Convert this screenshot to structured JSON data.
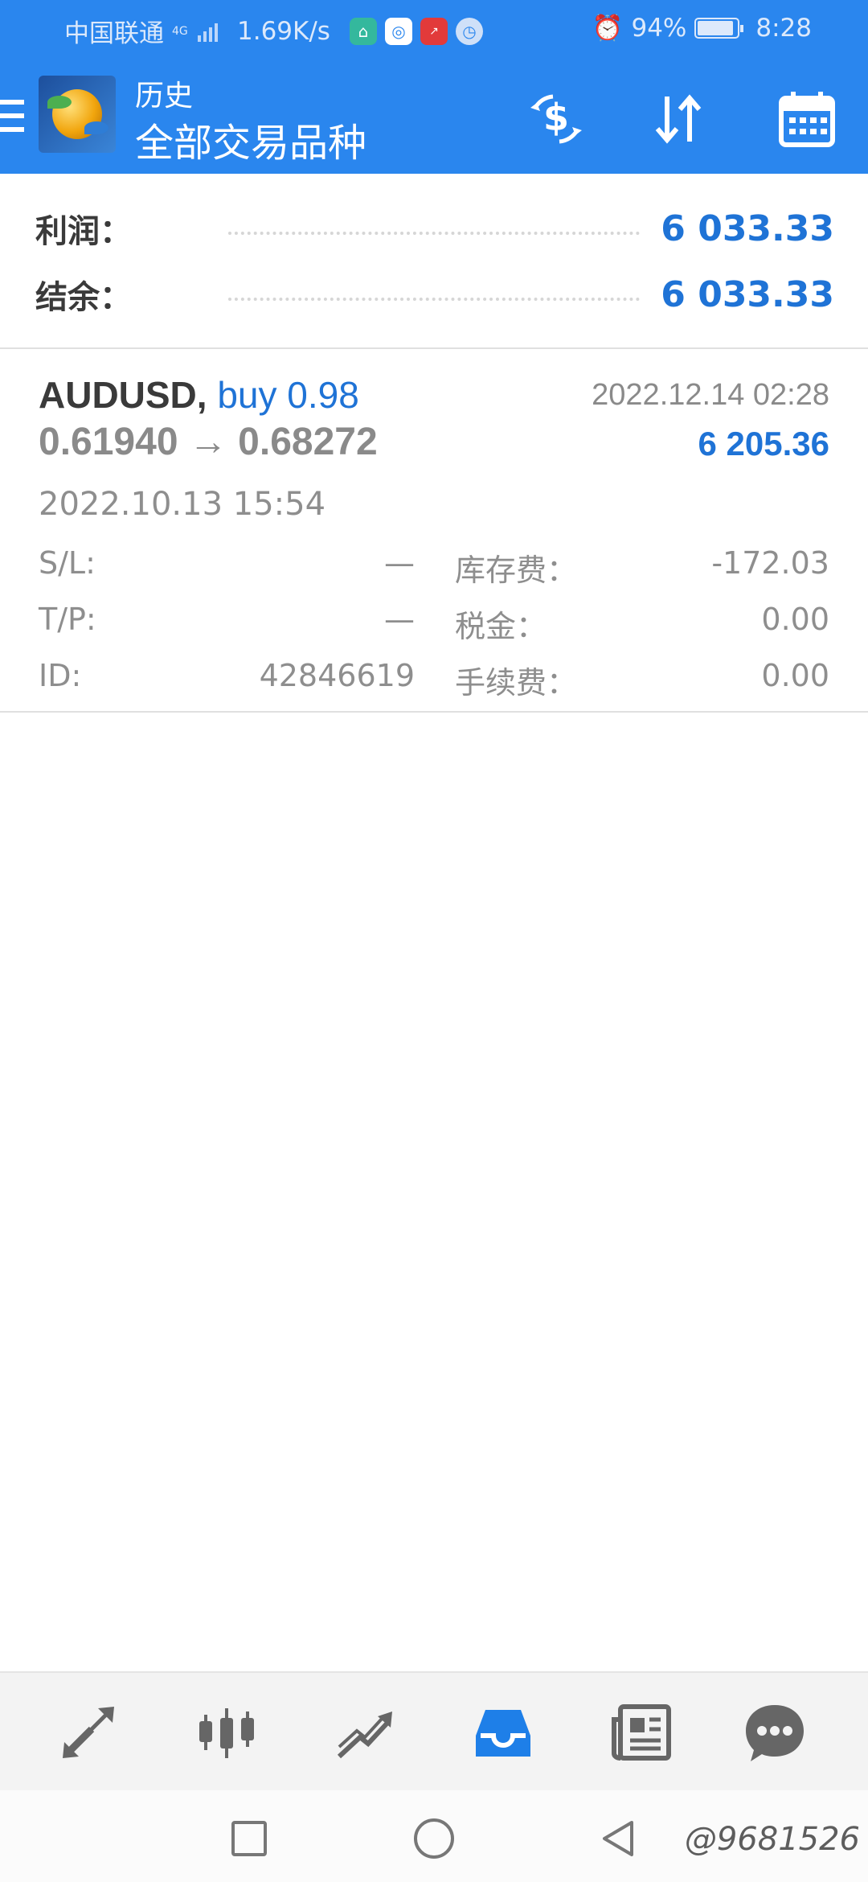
{
  "status_bar": {
    "carrier": "中国联通",
    "network_type": "4G",
    "net_speed": "1.69K/s",
    "battery": "94%",
    "time": "8:28",
    "notification_icons": [
      "home-app-icon",
      "browser-app-icon",
      "stock-app-icon",
      "clock-app-icon"
    ]
  },
  "app_bar": {
    "title_small": "历史",
    "title_large": "全部交易品种",
    "actions": [
      "dollar-refresh-icon",
      "sort-icon",
      "calendar-icon"
    ]
  },
  "summary": {
    "profit_label": "利润：",
    "profit_value": "6 033.33",
    "balance_label": "结余：",
    "balance_value": "6 033.33"
  },
  "deal": {
    "symbol": "AUDUSD,",
    "type_volume": "buy 0.98",
    "prices": "0.61940 → 0.68272",
    "close_time": "2022.12.14 02:28",
    "profit": "6 205.36",
    "open_time": "2022.10.13 15:54",
    "sl_label": "S/L:",
    "sl_value": "—",
    "tp_label": "T/P:",
    "tp_value": "—",
    "id_label": "ID:",
    "id_value": "42846619",
    "swap_label": "库存费：",
    "swap_value": "-172.03",
    "tax_label": "税金：",
    "tax_value": "0.00",
    "commission_label": "手续费：",
    "commission_value": "0.00"
  },
  "bottom_tabs": [
    "quotes-tab",
    "chart-tab",
    "trade-tab",
    "history-tab",
    "news-tab",
    "chat-tab"
  ],
  "active_tab": "history-tab",
  "watermark": "@9681526",
  "colors": {
    "primary": "#2a86ee",
    "accent_text": "#1f73d6"
  }
}
